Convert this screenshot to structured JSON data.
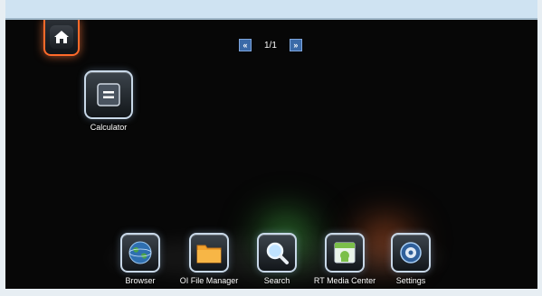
{
  "pager": {
    "prev_glyph": "«",
    "page_label": "1/1",
    "next_glyph": "»"
  },
  "desktop": {
    "apps": [
      {
        "label": "Calculator",
        "icon": "calculator-icon"
      }
    ]
  },
  "dock": {
    "items": [
      {
        "label": "Browser",
        "icon": "globe-icon"
      },
      {
        "label": "OI File Manager",
        "icon": "folder-icon"
      },
      {
        "label": "Search",
        "icon": "magnifier-icon"
      },
      {
        "label": "RT Media Center",
        "icon": "android-media-icon"
      },
      {
        "label": "Settings",
        "icon": "gear-icon"
      }
    ]
  },
  "colors": {
    "home_accent": "#ff6a2a",
    "pager_button": "#3b6aa8",
    "top_bar": "#cfe3f2",
    "folder": "#f2a12c"
  }
}
